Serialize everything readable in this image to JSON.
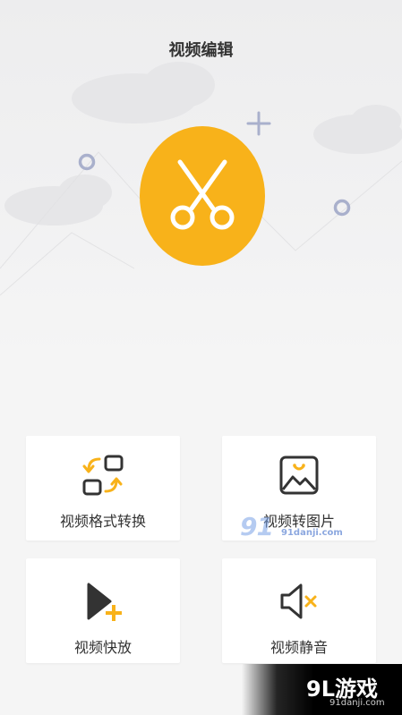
{
  "header": {
    "title": "视频编辑"
  },
  "hero": {
    "icon": "scissors-icon",
    "color": "#f8b21a"
  },
  "features": [
    {
      "label": "视频格式转换",
      "icon": "format-convert-icon"
    },
    {
      "label": "视频转图片",
      "icon": "image-icon"
    },
    {
      "label": "视频快放",
      "icon": "fast-play-icon"
    },
    {
      "label": "视频静音",
      "icon": "mute-icon"
    }
  ],
  "watermark": {
    "mid_logo": "91",
    "mid_url": "91danji.com",
    "logo_text": "9L游戏",
    "url": "91danji.com"
  },
  "colors": {
    "accent": "#f8b21a",
    "deco": "#a9b0cc",
    "icon_dark": "#333333"
  }
}
